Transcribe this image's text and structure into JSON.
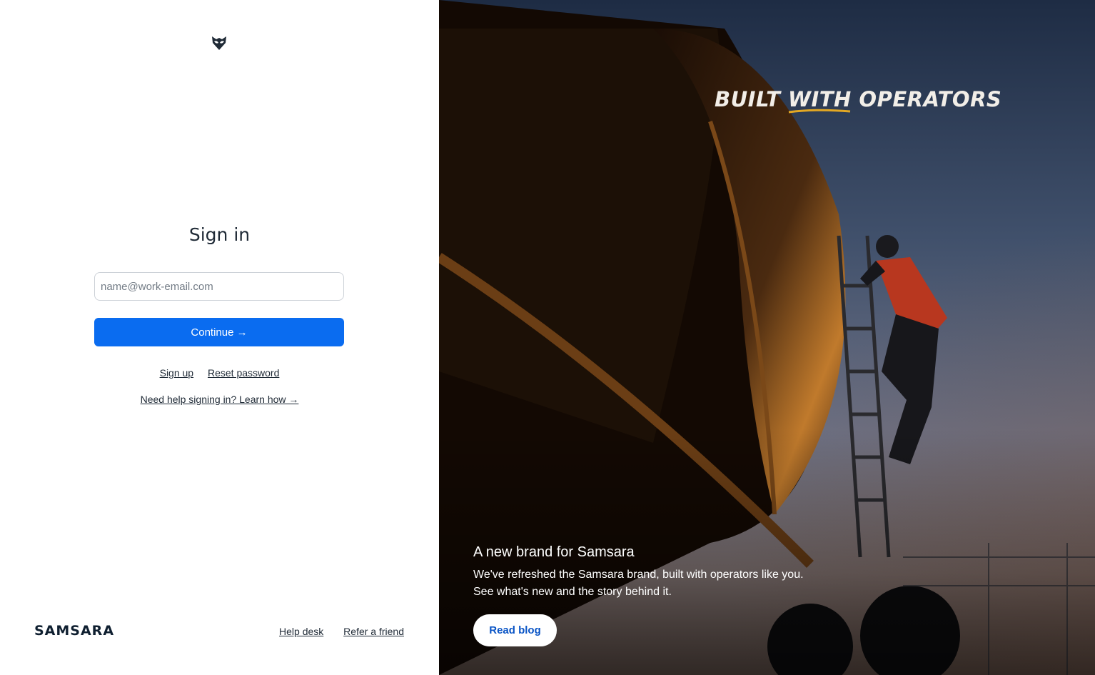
{
  "signin": {
    "title": "Sign in",
    "email_placeholder": "name@work-email.com",
    "email_value": "",
    "continue_label": "Continue →",
    "signup_label": "Sign up",
    "reset_label": "Reset password",
    "help_label": "Need help signing in? Learn how →"
  },
  "footer": {
    "brand": "SAMSARA",
    "help_desk": "Help desk",
    "refer": "Refer a friend"
  },
  "promo": {
    "hero_title": "BUILT WITH OPERATORS",
    "title": "A new brand for Samsara",
    "body_line1": "We've refreshed the Samsara brand, built with operators like you.",
    "body_line2": "See what's new and the story behind it.",
    "button": "Read blog"
  },
  "icons": {
    "top_logo": "samsara-owl-logo-icon"
  },
  "colors": {
    "primary_button": "#0a6cf0",
    "text": "#1f2a36",
    "hero_accent": "#e3a823"
  }
}
